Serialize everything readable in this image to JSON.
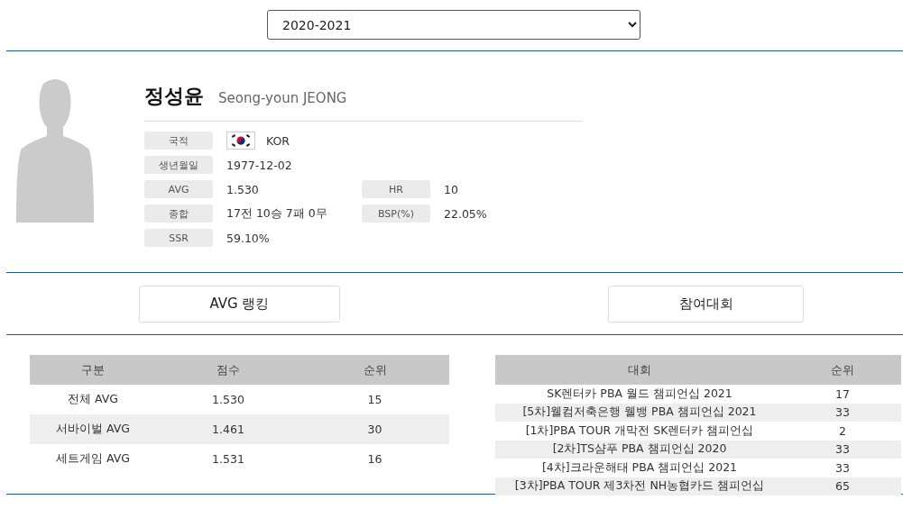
{
  "season_select": {
    "value": "2020-2021"
  },
  "player": {
    "name_ko": "정성윤",
    "name_en": "Seong-youn JEONG",
    "info_rows": [
      [
        {
          "label": "국적",
          "value": "KOR",
          "kind": "flag"
        }
      ],
      [
        {
          "label": "생년월일",
          "value": "1977-12-02",
          "kind": "text"
        }
      ],
      [
        {
          "label": "AVG",
          "value": "1.530",
          "kind": "text"
        },
        {
          "label": "HR",
          "value": "10",
          "kind": "text"
        }
      ],
      [
        {
          "label": "종합",
          "value": "17전 10승 7패 0무",
          "kind": "text"
        },
        {
          "label": "BSP(%)",
          "value": "22.05%",
          "kind": "text"
        }
      ],
      [
        {
          "label": "SSR",
          "value": "59.10%",
          "kind": "text"
        }
      ]
    ]
  },
  "buttons": [
    "AVG 랭킹",
    "참여대회"
  ],
  "ranking_table": {
    "columns": [
      "구분",
      "점수",
      "순위"
    ],
    "rows": [
      [
        "전체 AVG",
        "1.530",
        "15"
      ],
      [
        "서바이벌 AVG",
        "1.461",
        "30"
      ],
      [
        "세트게임 AVG",
        "1.531",
        "16"
      ]
    ]
  },
  "tournament_table": {
    "columns": [
      "대회",
      "순위"
    ],
    "rows": [
      [
        "SK렌터카 PBA 월드 챔피언십 2021",
        "17"
      ],
      [
        "[5차]웰컴저축은행 웰뱅 PBA 챔피언십 2021",
        "33"
      ],
      [
        "[1차]PBA TOUR 개막전 SK렌터카 챔피언십",
        "2"
      ],
      [
        "[2차]TS샴푸 PBA 챔피언십 2020",
        "33"
      ],
      [
        "[4차]크라운해태 PBA 챔피언십 2021",
        "33"
      ],
      [
        "[3차]PBA TOUR 제3차전 NH농협카드 챔피언십",
        "65"
      ]
    ]
  }
}
